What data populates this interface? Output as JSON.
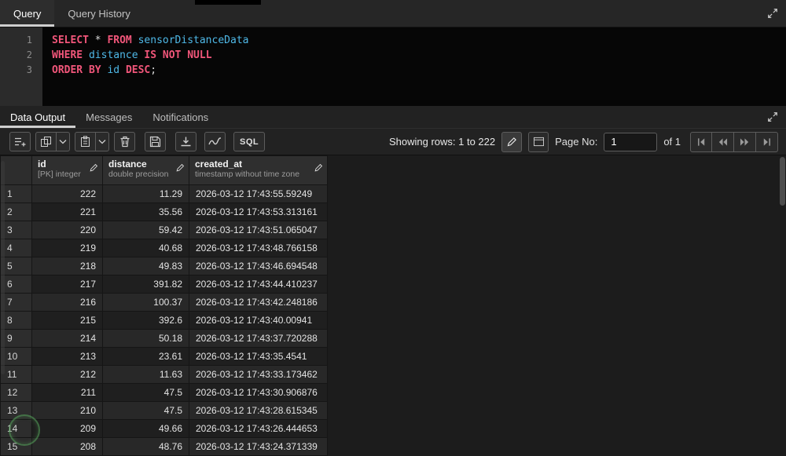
{
  "colors": {
    "keyword": "#f1567a",
    "identifier": "#4fb9e8"
  },
  "window": {
    "top_tabs": [
      {
        "label": "Query",
        "active": true
      },
      {
        "label": "Query History",
        "active": false
      }
    ]
  },
  "editor": {
    "lines": [
      {
        "num": "1",
        "tokens": [
          [
            "SELECT",
            "kw"
          ],
          [
            " ",
            "df"
          ],
          [
            "*",
            "df"
          ],
          [
            " ",
            "df"
          ],
          [
            "FROM",
            "kw"
          ],
          [
            " ",
            "df"
          ],
          [
            "sensorDistanceData",
            "id"
          ]
        ]
      },
      {
        "num": "2",
        "tokens": [
          [
            "WHERE",
            "kw"
          ],
          [
            " ",
            "df"
          ],
          [
            "distance",
            "id"
          ],
          [
            " ",
            "df"
          ],
          [
            "IS",
            "kw"
          ],
          [
            " ",
            "df"
          ],
          [
            "NOT",
            "kw"
          ],
          [
            " ",
            "df"
          ],
          [
            "NULL",
            "kw"
          ]
        ]
      },
      {
        "num": "3",
        "tokens": [
          [
            "ORDER",
            "kw"
          ],
          [
            " ",
            "df"
          ],
          [
            "BY",
            "kw"
          ],
          [
            " ",
            "df"
          ],
          [
            "id",
            "id"
          ],
          [
            " ",
            "df"
          ],
          [
            "DESC",
            "kw"
          ],
          [
            ";",
            "df"
          ]
        ]
      }
    ]
  },
  "output": {
    "tabs": [
      {
        "label": "Data Output",
        "active": true
      },
      {
        "label": "Messages",
        "active": false
      },
      {
        "label": "Notifications",
        "active": false
      }
    ],
    "toolbar": {
      "sql_label": "SQL",
      "showing_rows": "Showing rows: 1 to 222",
      "page_no_label": "Page No:",
      "page_value": "1",
      "of_label": "of 1"
    }
  },
  "table": {
    "columns": [
      {
        "name": "id",
        "sub": "[PK] integer"
      },
      {
        "name": "distance",
        "sub": "double precision"
      },
      {
        "name": "created_at",
        "sub": "timestamp without time zone"
      }
    ],
    "rows": [
      [
        "1",
        "222",
        "11.29",
        "2026-03-12 17:43:55.59249"
      ],
      [
        "2",
        "221",
        "35.56",
        "2026-03-12 17:43:53.313161"
      ],
      [
        "3",
        "220",
        "59.42",
        "2026-03-12 17:43:51.065047"
      ],
      [
        "4",
        "219",
        "40.68",
        "2026-03-12 17:43:48.766158"
      ],
      [
        "5",
        "218",
        "49.83",
        "2026-03-12 17:43:46.694548"
      ],
      [
        "6",
        "217",
        "391.82",
        "2026-03-12 17:43:44.410237"
      ],
      [
        "7",
        "216",
        "100.37",
        "2026-03-12 17:43:42.248186"
      ],
      [
        "8",
        "215",
        "392.6",
        "2026-03-12 17:43:40.00941"
      ],
      [
        "9",
        "214",
        "50.18",
        "2026-03-12 17:43:37.720288"
      ],
      [
        "10",
        "213",
        "23.61",
        "2026-03-12 17:43:35.4541"
      ],
      [
        "11",
        "212",
        "11.63",
        "2026-03-12 17:43:33.173462"
      ],
      [
        "12",
        "211",
        "47.5",
        "2026-03-12 17:43:30.906876"
      ],
      [
        "13",
        "210",
        "47.5",
        "2026-03-12 17:43:28.615345"
      ],
      [
        "14",
        "209",
        "49.66",
        "2026-03-12 17:43:26.444653"
      ],
      [
        "15",
        "208",
        "48.76",
        "2026-03-12 17:43:24.371339"
      ]
    ]
  }
}
